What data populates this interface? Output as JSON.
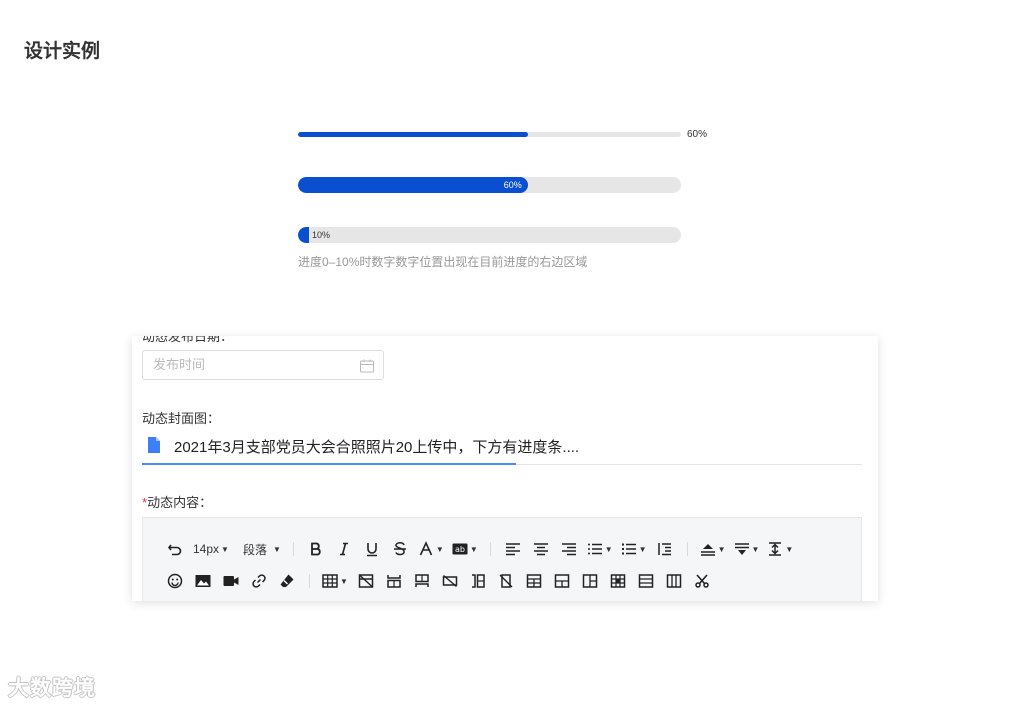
{
  "page_title": "设计实例",
  "progress": {
    "bar1": {
      "value": 0.6,
      "label": "60%"
    },
    "bar2": {
      "value": 0.6,
      "label": "60%"
    },
    "bar3": {
      "value": 0.1,
      "label": "10%"
    },
    "note": "进度0–10%时数字数字位置出现在目前进度的右边区域",
    "accent_color": "#0b4fd1"
  },
  "form": {
    "partial_label": "动态发布日期：",
    "date_placeholder": "发布时间",
    "cover_label": "动态封面图：",
    "file_name": "2021年3月支部党员大会合照照片20上传中，下方有进度条....",
    "file_upload_progress": 0.52,
    "content_required_mark": "*",
    "content_label": "动态内容："
  },
  "toolbar": {
    "font_size": "14px",
    "paragraph": "段落"
  },
  "watermark": "大数跨境"
}
